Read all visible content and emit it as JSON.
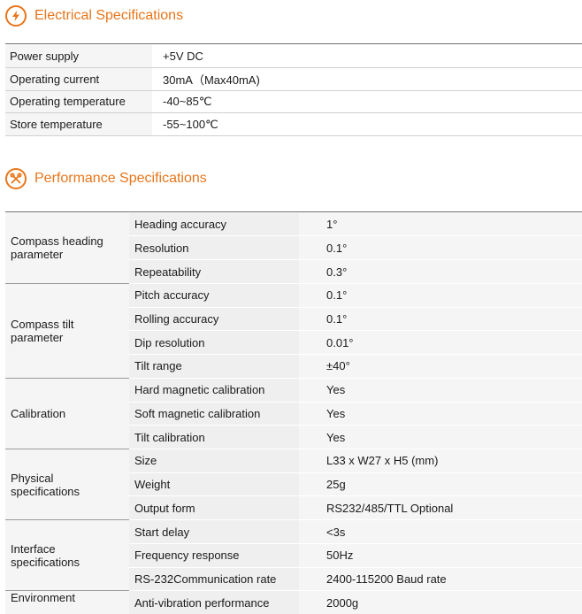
{
  "electrical": {
    "title": "Electrical Specifications",
    "icon": "lightning-icon",
    "rows": [
      {
        "label": "Power supply",
        "value": "+5V DC"
      },
      {
        "label": "Operating  current",
        "value": "30mA（Max40mA)"
      },
      {
        "label": "Operating  temperature",
        "value": "-40~85℃"
      },
      {
        "label": "Store temperature",
        "value": "-55~100℃"
      }
    ]
  },
  "performance": {
    "title": "Performance Specifications",
    "icon": "tools-icon",
    "groups": [
      {
        "name": "Compass heading parameter",
        "rows": [
          {
            "param": "Heading accuracy",
            "value": "1°"
          },
          {
            "param": "Resolution",
            "value": "0.1°"
          },
          {
            "param": "Repeatability",
            "value": "0.3°"
          }
        ]
      },
      {
        "name": "Compass tilt parameter",
        "rows": [
          {
            "param": "Pitch accuracy",
            "value": "0.1°"
          },
          {
            "param": "Rolling accuracy",
            "value": "0.1°"
          },
          {
            "param": "Dip resolution",
            "value": "0.01°"
          },
          {
            "param": "Tilt range",
            "value": "±40°"
          }
        ]
      },
      {
        "name": "Calibration",
        "rows": [
          {
            "param": "Hard magnetic calibration",
            "value": "Yes"
          },
          {
            "param": "Soft magnetic calibration",
            "value": "Yes"
          },
          {
            "param": "Tilt calibration",
            "value": "Yes"
          }
        ]
      },
      {
        "name": "Physical specifications",
        "rows": [
          {
            "param": "Size",
            "value": "L33 x W27 x H5 (mm)"
          },
          {
            "param": "Weight",
            "value": "25g"
          },
          {
            "param": "Output form",
            "value": "RS232/485/TTL Optional"
          }
        ]
      },
      {
        "name": "Interface specifications",
        "rows": [
          {
            "param": "Start delay",
            "value": "<3s"
          },
          {
            "param": "Frequency response",
            "value": "50Hz"
          },
          {
            "param": "RS-232Communication rate",
            "value": "2400-115200 Baud rate"
          }
        ]
      },
      {
        "name": "Environment",
        "rows": [
          {
            "param": "Anti-vibration performance",
            "value": "2000g"
          }
        ]
      }
    ]
  },
  "colors": {
    "accent": "#e8751a",
    "rule": "#6e6e6e"
  }
}
